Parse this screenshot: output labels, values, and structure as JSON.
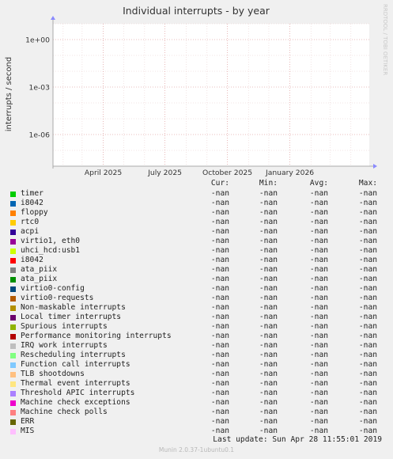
{
  "chart_data": {
    "type": "line",
    "title": "Individual interrupts - by year",
    "ylabel": "interrupts / second",
    "xlabel": "",
    "watermark": "RRDTOOL / TOBI OETIKER",
    "yscale": "log",
    "ylim": [
      1e-08,
      10
    ],
    "y_ticks": [
      {
        "value": 1,
        "label": "1e+00"
      },
      {
        "value": 0.001,
        "label": "1e-03"
      },
      {
        "value": 1e-06,
        "label": "1e-06"
      }
    ],
    "x_range": [
      "2025-01-17",
      "2026-04-28"
    ],
    "x_ticks": [
      {
        "date": "2025-04-01",
        "label": "April 2025"
      },
      {
        "date": "2025-07-01",
        "label": "July 2025"
      },
      {
        "date": "2025-10-01",
        "label": "October 2025"
      },
      {
        "date": "2026-01-01",
        "label": "January 2026"
      }
    ],
    "grid": true,
    "legend_position": "bottom",
    "columns": [
      "Cur:",
      "Min:",
      "Avg:",
      "Max:"
    ],
    "series": [
      {
        "name": "timer",
        "color": "#00cc00",
        "cur": "-nan",
        "min": "-nan",
        "avg": "-nan",
        "max": "-nan"
      },
      {
        "name": "i8042",
        "color": "#0066b3",
        "cur": "-nan",
        "min": "-nan",
        "avg": "-nan",
        "max": "-nan"
      },
      {
        "name": "floppy",
        "color": "#ff8000",
        "cur": "-nan",
        "min": "-nan",
        "avg": "-nan",
        "max": "-nan"
      },
      {
        "name": "rtc0",
        "color": "#ffcc00",
        "cur": "-nan",
        "min": "-nan",
        "avg": "-nan",
        "max": "-nan"
      },
      {
        "name": "acpi",
        "color": "#330099",
        "cur": "-nan",
        "min": "-nan",
        "avg": "-nan",
        "max": "-nan"
      },
      {
        "name": "virtio1, eth0",
        "color": "#990099",
        "cur": "-nan",
        "min": "-nan",
        "avg": "-nan",
        "max": "-nan"
      },
      {
        "name": "uhci_hcd:usb1",
        "color": "#ccff00",
        "cur": "-nan",
        "min": "-nan",
        "avg": "-nan",
        "max": "-nan"
      },
      {
        "name": "i8042",
        "color": "#ff0000",
        "cur": "-nan",
        "min": "-nan",
        "avg": "-nan",
        "max": "-nan"
      },
      {
        "name": "ata_piix",
        "color": "#808080",
        "cur": "-nan",
        "min": "-nan",
        "avg": "-nan",
        "max": "-nan"
      },
      {
        "name": "ata_piix",
        "color": "#008f00",
        "cur": "-nan",
        "min": "-nan",
        "avg": "-nan",
        "max": "-nan"
      },
      {
        "name": "virtio0-config",
        "color": "#00487d",
        "cur": "-nan",
        "min": "-nan",
        "avg": "-nan",
        "max": "-nan"
      },
      {
        "name": "virtio0-requests",
        "color": "#b35a00",
        "cur": "-nan",
        "min": "-nan",
        "avg": "-nan",
        "max": "-nan"
      },
      {
        "name": "Non-maskable interrupts",
        "color": "#b38f00",
        "cur": "-nan",
        "min": "-nan",
        "avg": "-nan",
        "max": "-nan"
      },
      {
        "name": "Local timer interrupts",
        "color": "#6b006b",
        "cur": "-nan",
        "min": "-nan",
        "avg": "-nan",
        "max": "-nan"
      },
      {
        "name": "Spurious interrupts",
        "color": "#8fb300",
        "cur": "-nan",
        "min": "-nan",
        "avg": "-nan",
        "max": "-nan"
      },
      {
        "name": "Performance monitoring interrupts",
        "color": "#b30000",
        "cur": "-nan",
        "min": "-nan",
        "avg": "-nan",
        "max": "-nan"
      },
      {
        "name": "IRQ work interrupts",
        "color": "#bebebe",
        "cur": "-nan",
        "min": "-nan",
        "avg": "-nan",
        "max": "-nan"
      },
      {
        "name": "Rescheduling interrupts",
        "color": "#80ff80",
        "cur": "-nan",
        "min": "-nan",
        "avg": "-nan",
        "max": "-nan"
      },
      {
        "name": "Function call interrupts",
        "color": "#80c9ff",
        "cur": "-nan",
        "min": "-nan",
        "avg": "-nan",
        "max": "-nan"
      },
      {
        "name": "TLB shootdowns",
        "color": "#ffc080",
        "cur": "-nan",
        "min": "-nan",
        "avg": "-nan",
        "max": "-nan"
      },
      {
        "name": "Thermal event interrupts",
        "color": "#ffe680",
        "cur": "-nan",
        "min": "-nan",
        "avg": "-nan",
        "max": "-nan"
      },
      {
        "name": "Threshold APIC interrupts",
        "color": "#aa80ff",
        "cur": "-nan",
        "min": "-nan",
        "avg": "-nan",
        "max": "-nan"
      },
      {
        "name": "Machine check exceptions",
        "color": "#ee00cc",
        "cur": "-nan",
        "min": "-nan",
        "avg": "-nan",
        "max": "-nan"
      },
      {
        "name": "Machine check polls",
        "color": "#ff8080",
        "cur": "-nan",
        "min": "-nan",
        "avg": "-nan",
        "max": "-nan"
      },
      {
        "name": "ERR",
        "color": "#666600",
        "cur": "-nan",
        "min": "-nan",
        "avg": "-nan",
        "max": "-nan"
      },
      {
        "name": "MIS",
        "color": "#ffbfff",
        "cur": "-nan",
        "min": "-nan",
        "avg": "-nan",
        "max": "-nan"
      }
    ]
  },
  "last_update": "Last update: Sun Apr 28 11:55:01 2019",
  "footer": "Munin 2.0.37-1ubuntu0.1"
}
